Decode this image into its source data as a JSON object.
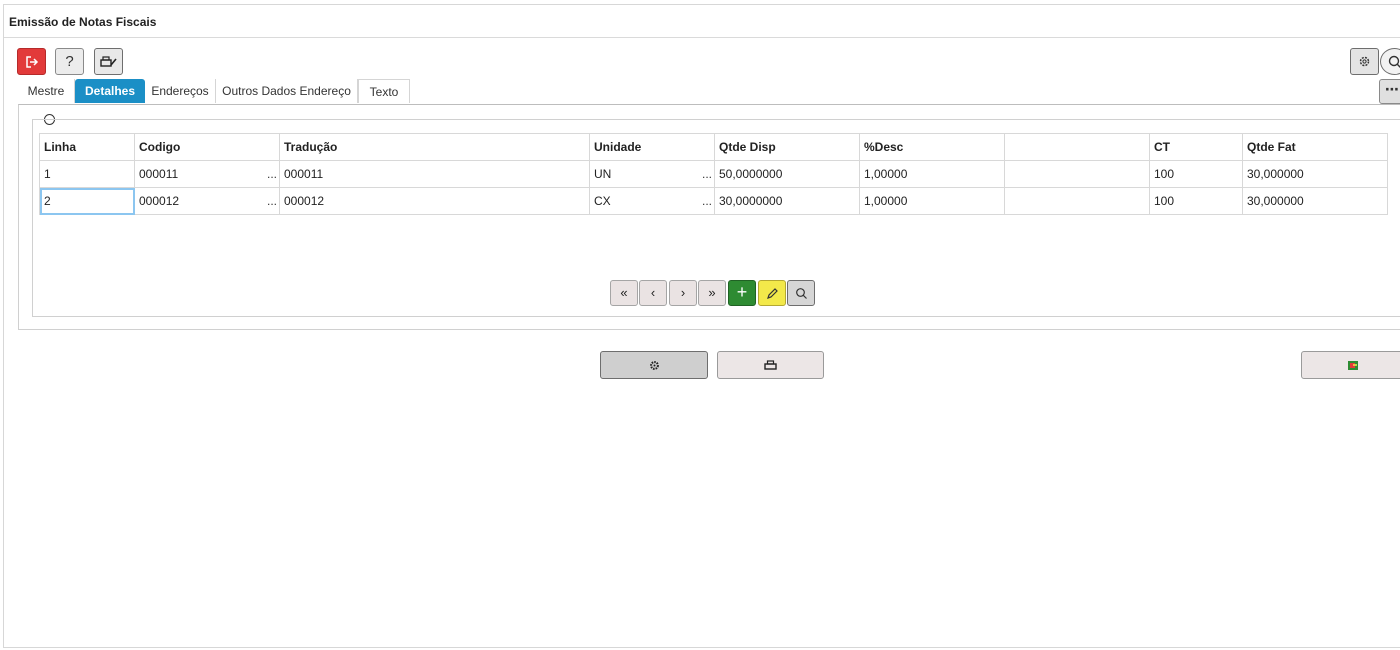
{
  "window": {
    "title": "Emissão de Notas Fiscais"
  },
  "toolbar": {
    "exit_icon": "exit-icon",
    "help_label": "?",
    "print_icon": "printer-edit-icon",
    "settings_icon": "gear-icon",
    "search_icon": "search-icon",
    "accent_color": "#e23a3a"
  },
  "tabs": [
    {
      "label": "Mestre",
      "active": false
    },
    {
      "label": "Detalhes",
      "active": true
    },
    {
      "label": "Endereços",
      "active": false
    },
    {
      "label": "Outros Dados Endereço",
      "active": false
    },
    {
      "label": "Texto",
      "active": false
    }
  ],
  "more_label": "⋯",
  "grid": {
    "columns": [
      "Linha",
      "Codigo",
      "Tradução",
      "Unidade",
      "Qtde Disp",
      "%Desc",
      "",
      "CT",
      "Qtde Fat"
    ],
    "rows": [
      [
        "1",
        "000011",
        "000011",
        "UN",
        "50,0000000",
        "1,00000",
        "",
        "100",
        "30,000000"
      ],
      [
        "2",
        "000012",
        "000012",
        "CX",
        "30,0000000",
        "1,00000",
        "",
        "100",
        "30,000000"
      ]
    ],
    "lookup_marker": "..."
  },
  "pager": {
    "first": "«",
    "prev": "‹",
    "next": "›",
    "last": "»",
    "add": "+",
    "edit_icon": "pencil-icon",
    "search_icon": "search-icon",
    "add_color": "#2e8b32",
    "edit_color": "#f3e94a"
  },
  "actions": {
    "process_icon": "gear-icon",
    "print_icon": "printer-icon",
    "export_icon": "export-icon"
  },
  "colors": {
    "active_tab": "#1b8fc6"
  }
}
